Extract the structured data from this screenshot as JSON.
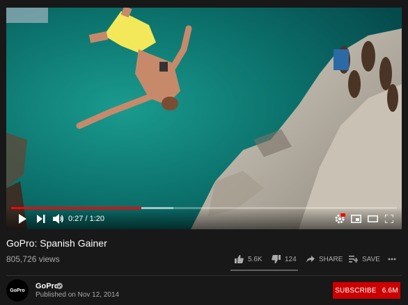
{
  "player": {
    "current_time": "0:27",
    "time_separator": " / ",
    "duration": "1:20",
    "progress_fraction": 0.3375,
    "buffered_fraction": 0.42
  },
  "video": {
    "title": "GoPro: Spanish Gainer",
    "views": "805,726 views"
  },
  "actions": {
    "likes": "5.6K",
    "dislikes": "124",
    "share": "SHARE",
    "save": "SAVE"
  },
  "channel": {
    "name": "GoPro",
    "avatar_text": "GoPro",
    "published": "Published on Nov 12, 2014",
    "subscribe_label": "SUBSCRIBE",
    "subscriber_count": "6.6M"
  },
  "colors": {
    "accent": "#ff0000",
    "subscribe": "#cc0000",
    "background": "#181818"
  },
  "icons": [
    "play-icon",
    "next-icon",
    "volume-icon",
    "settings-icon",
    "miniplayer-icon",
    "theater-icon",
    "fullscreen-icon",
    "thumbs-up-icon",
    "thumbs-down-icon",
    "share-icon",
    "playlist-add-icon",
    "more-icon",
    "verified-icon"
  ]
}
